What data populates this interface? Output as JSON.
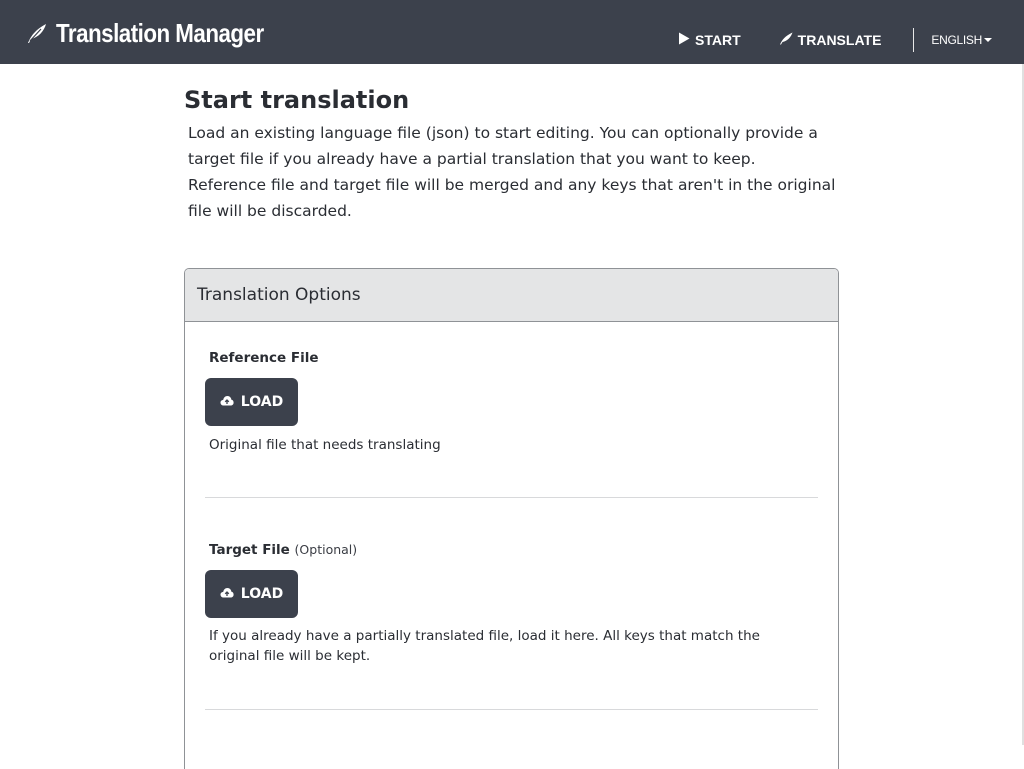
{
  "app": {
    "title": "Translation Manager",
    "logo_icon": "feather-icon"
  },
  "nav": {
    "start_label": "START",
    "translate_label": "TRANSLATE",
    "language_label": "ENGLISH",
    "start_icon": "play-icon",
    "translate_icon": "feather-icon"
  },
  "page": {
    "title": "Start translation",
    "intro": "Load an existing language file (json) to start editing. You can optionally provide a target file if you already have a partial translation that you want to keep. Reference file and target file will be merged and any keys that aren't in the original file will be discarded."
  },
  "options": {
    "title": "Translation Options",
    "reference": {
      "label": "Reference File",
      "button_label": "LOAD",
      "help": "Original file that needs translating"
    },
    "target": {
      "label": "Target File",
      "optional": "(Optional)",
      "button_label": "LOAD",
      "help": "If you already have a partially translated file, load it here. All keys that match the original file will be kept."
    }
  },
  "colors": {
    "navbar": "#3c414c",
    "button": "#3c414c",
    "card_header": "#e4e5e6"
  }
}
